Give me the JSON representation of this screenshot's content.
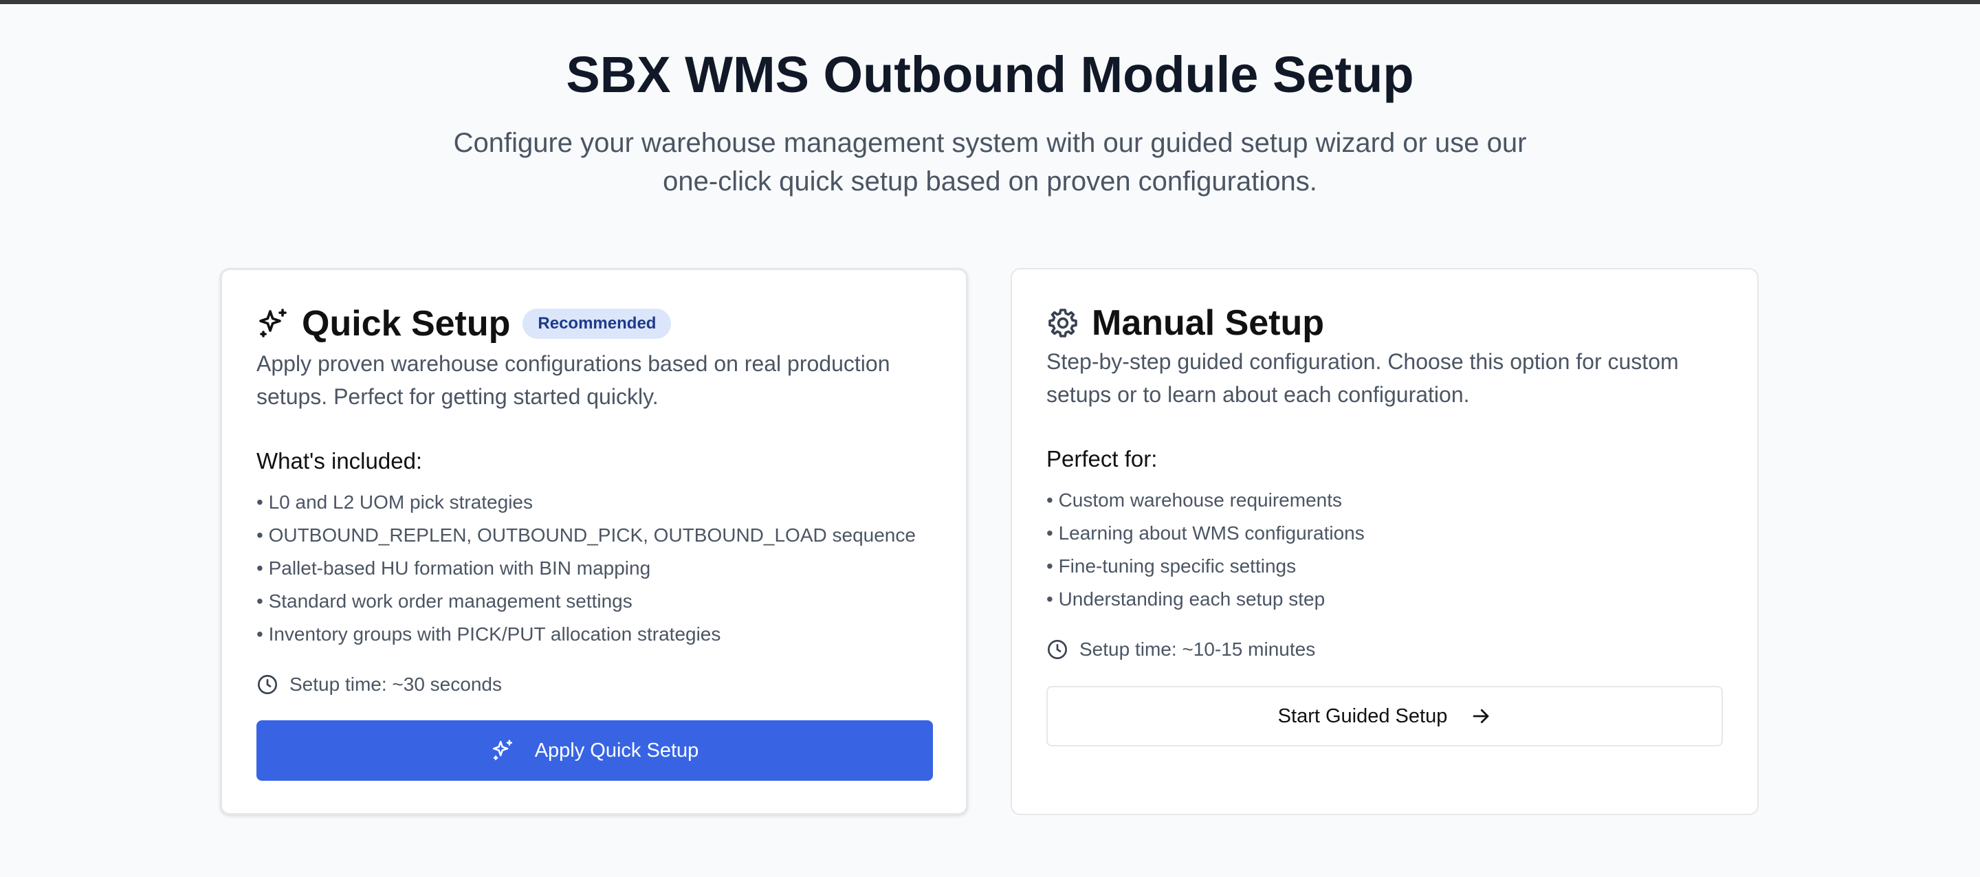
{
  "page": {
    "title": "SBX WMS Outbound Module Setup",
    "subtitle": "Configure your warehouse management system with our guided setup wizard or use our one-click quick setup based on proven configurations."
  },
  "quick_setup": {
    "icon": "sparkles-icon",
    "title": "Quick Setup",
    "badge": "Recommended",
    "description": "Apply proven warehouse configurations based on real production setups. Perfect for getting started quickly.",
    "section_title": "What's included:",
    "items": [
      "• L0 and L2 UOM pick strategies",
      "• OUTBOUND_REPLEN, OUTBOUND_PICK, OUTBOUND_LOAD sequence",
      "• Pallet-based HU formation with BIN mapping",
      "• Standard work order management settings",
      "• Inventory groups with PICK/PUT allocation strategies"
    ],
    "setup_time": "Setup time: ~30 seconds",
    "button_label": "Apply Quick Setup",
    "button_color": "#3864e4"
  },
  "manual_setup": {
    "icon": "gear-icon",
    "title": "Manual Setup",
    "description": "Step-by-step guided configuration. Choose this option for custom setups or to learn about each configuration.",
    "section_title": "Perfect for:",
    "items": [
      "• Custom warehouse requirements",
      "• Learning about WMS configurations",
      "• Fine-tuning specific settings",
      "• Understanding each setup step"
    ],
    "setup_time": "Setup time: ~10-15 minutes",
    "button_label": "Start Guided Setup"
  }
}
